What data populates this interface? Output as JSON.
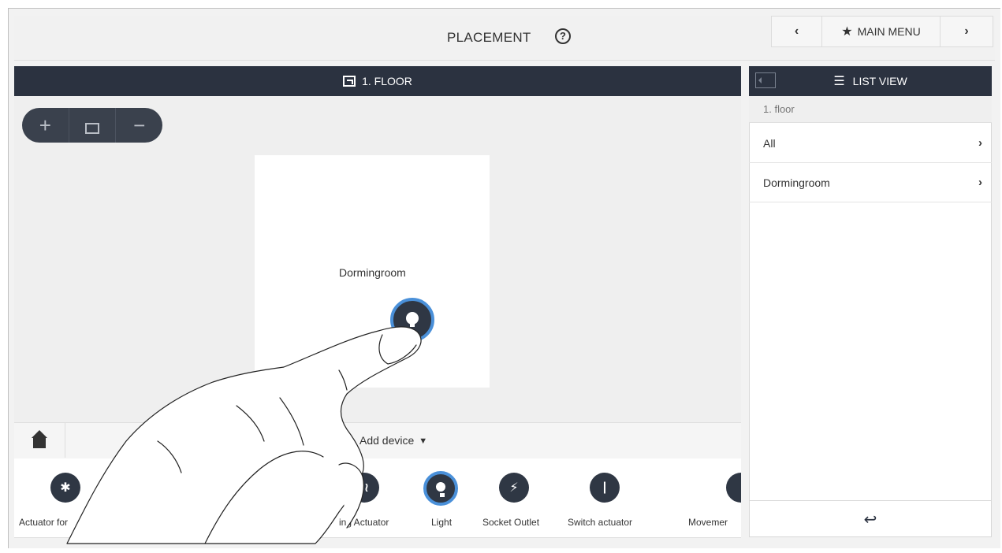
{
  "header": {
    "title": "PLACEMENT",
    "help_icon": "?",
    "nav_prev": "‹",
    "nav_main": "MAIN MENU",
    "nav_next": "›"
  },
  "floor": {
    "title": "1. FLOOR",
    "zoom_in": "+",
    "zoom_out": "−"
  },
  "room": {
    "name": "Dormingroom"
  },
  "add_device": {
    "label": "Add device",
    "chevron": "⌄"
  },
  "devices": [
    {
      "label": "Actuator for",
      "icon": "blind-actuator-icon"
    },
    {
      "label": "ing Actuator",
      "icon": "heating-actuator-icon"
    },
    {
      "label": "Light",
      "icon": "light-icon",
      "selected": true
    },
    {
      "label": "Socket Outlet",
      "icon": "socket-outlet-icon"
    },
    {
      "label": "Switch actuator",
      "icon": "switch-actuator-icon"
    },
    {
      "label": "Movemer",
      "icon": "movement-detector-icon"
    }
  ],
  "list_view": {
    "title": "LIST VIEW",
    "breadcrumb": "1. floor",
    "items": [
      {
        "label": "All"
      },
      {
        "label": "Dormingroom"
      }
    ],
    "back_icon": "↩"
  },
  "colors": {
    "dark_bar": "#2b3240",
    "accent_blue": "#4a90d9",
    "background": "#efefef"
  }
}
